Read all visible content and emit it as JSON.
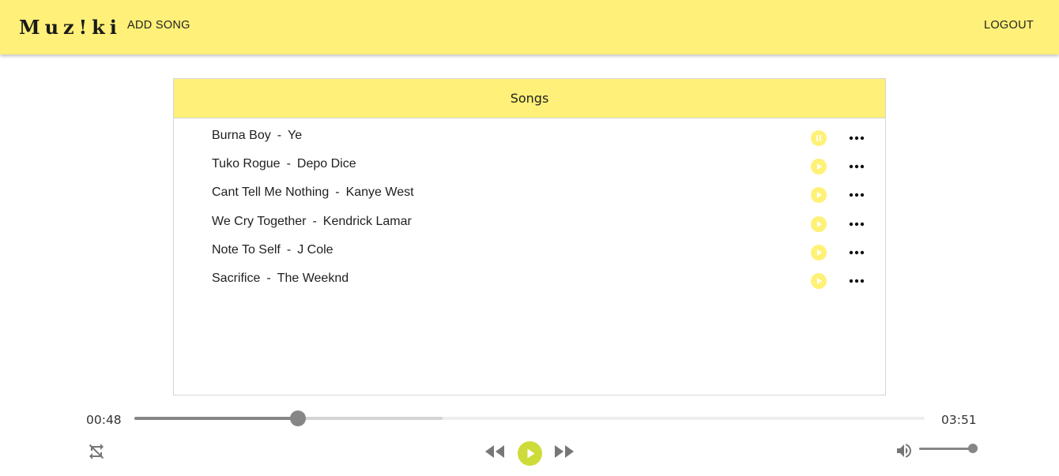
{
  "app": {
    "logo": "Muz!ki",
    "add_song_label": "ADD SONG",
    "logout_label": "LOGOUT",
    "accent_color": "#fef078"
  },
  "songs_panel": {
    "header": "Songs",
    "separator": "-",
    "songs": [
      {
        "title": "Burna Boy",
        "artist": "Ye",
        "state": "playing",
        "state_icon": "pause-icon"
      },
      {
        "title": "Tuko Rogue",
        "artist": "Depo Dice",
        "state": "idle",
        "state_icon": "play-icon"
      },
      {
        "title": "Cant Tell Me Nothing",
        "artist": "Kanye West",
        "state": "idle",
        "state_icon": "play-icon"
      },
      {
        "title": "We Cry Together",
        "artist": "Kendrick Lamar",
        "state": "idle",
        "state_icon": "play-icon"
      },
      {
        "title": "Note To Self",
        "artist": "J Cole",
        "state": "idle",
        "state_icon": "play-icon"
      },
      {
        "title": "Sacrifice",
        "artist": "The Weeknd",
        "state": "idle",
        "state_icon": "play-icon"
      }
    ]
  },
  "player": {
    "current_time": "00:48",
    "total_time": "03:51",
    "progress_fraction": 0.207,
    "buffered_fraction": 0.39,
    "volume_fraction": 1.0,
    "play_button_color": "#cddc39",
    "icons": {
      "repeat": "repeat-off-icon",
      "rewind": "fast-rewind-icon",
      "play": "play-icon",
      "forward": "fast-forward-icon",
      "volume": "volume-up-icon"
    }
  }
}
